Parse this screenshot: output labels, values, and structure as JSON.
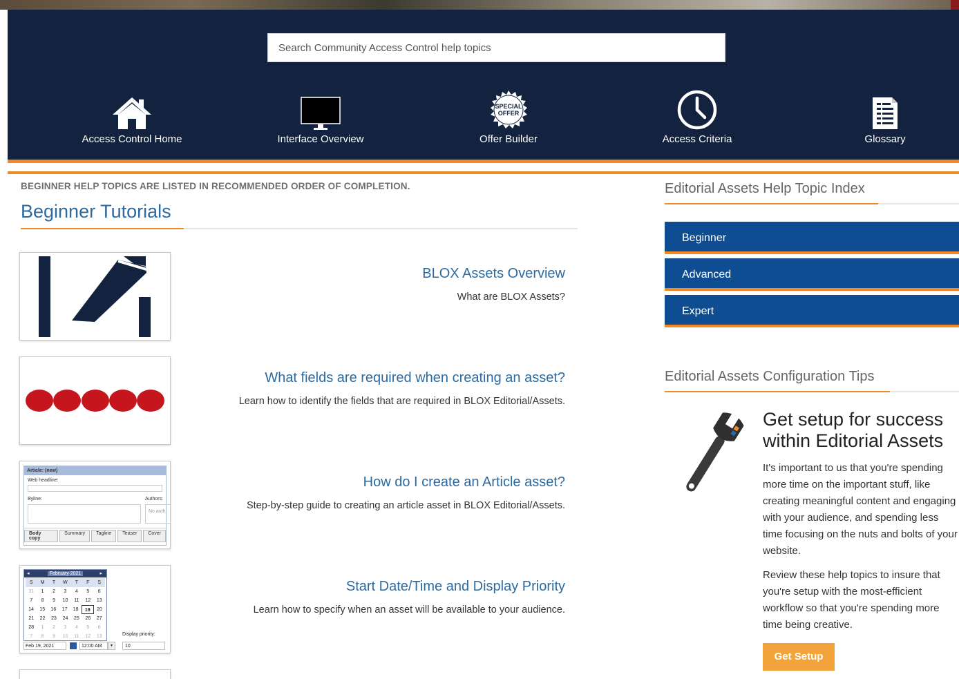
{
  "search": {
    "placeholder": "Search Community Access Control help topics"
  },
  "nav": [
    {
      "label": "Access Control Home",
      "icon": "home-icon"
    },
    {
      "label": "Interface Overview",
      "icon": "monitor-icon"
    },
    {
      "label": "Offer Builder",
      "icon": "special-offer-badge-icon",
      "badge_line1": "SPECIAL",
      "badge_line2": "OFFER"
    },
    {
      "label": "Access Criteria",
      "icon": "clock-icon"
    },
    {
      "label": "Glossary",
      "icon": "document-list-icon"
    }
  ],
  "main": {
    "intro": "BEGINNER HELP TOPICS ARE LISTED IN RECOMMENDED ORDER OF COMPLETION.",
    "title": "Beginner Tutorials",
    "tutorials": [
      {
        "title": "BLOX Assets Overview",
        "description": "What are BLOX Assets?"
      },
      {
        "title": "What fields are required when creating an asset?",
        "description": "Learn how to identify the fields that are required in BLOX Editorial/Assets."
      },
      {
        "title": "How do I create an Article asset?",
        "description": "Step-by-step guide to creating an article asset in BLOX Editorial/Assets."
      },
      {
        "title": "Start Date/Time and Display Priority",
        "description": "Learn how to specify when an asset will be available to your audience."
      }
    ],
    "article_thumb": {
      "header": "Article: (new)",
      "web_headline": "Web headline:",
      "byline": "Byline:",
      "authors": "Authors:",
      "no_auth": "No auth",
      "tabs": [
        "Body copy",
        "Summary",
        "Tagline",
        "Teaser",
        "Cover"
      ]
    },
    "calendar_thumb": {
      "month": "February 2021",
      "days": [
        "S",
        "M",
        "T",
        "W",
        "T",
        "F",
        "S"
      ],
      "rows": [
        [
          "31",
          "1",
          "2",
          "3",
          "4",
          "5",
          "6"
        ],
        [
          "7",
          "8",
          "9",
          "10",
          "11",
          "12",
          "13"
        ],
        [
          "14",
          "15",
          "16",
          "17",
          "18",
          "19",
          "20"
        ],
        [
          "21",
          "22",
          "23",
          "24",
          "25",
          "26",
          "27"
        ],
        [
          "28",
          "1",
          "2",
          "3",
          "4",
          "5",
          "6"
        ],
        [
          "7",
          "8",
          "9",
          "10",
          "11",
          "12",
          "13"
        ]
      ],
      "date_value": "Feb 19, 2021",
      "time_value": "12:00 AM",
      "priority_label": "Display priority:",
      "priority_value": "10"
    }
  },
  "sidebar": {
    "index_title": "Editorial Assets Help Topic Index",
    "levels": [
      "Beginner",
      "Advanced",
      "Expert"
    ],
    "tips_title": "Editorial Assets Configuration Tips",
    "tip_heading": "Get setup for success within Editorial Assets",
    "tip_text_1": "It's important to us that you're spending more time on the important stuff, like creating meaningful content and engaging with your audience, and spending less time focusing on the nuts and bolts of your website.",
    "tip_text_2": "Review these help topics to insure that you're setup with the most-efficient workflow so that you're spending more time being creative.",
    "tip_button": "Get Setup"
  },
  "colors": {
    "navy": "#13233f",
    "accent_orange": "#f08a24",
    "link_blue": "#2c6aa0",
    "button_blue": "#0e4d91",
    "button_orange": "#f2a43a"
  }
}
